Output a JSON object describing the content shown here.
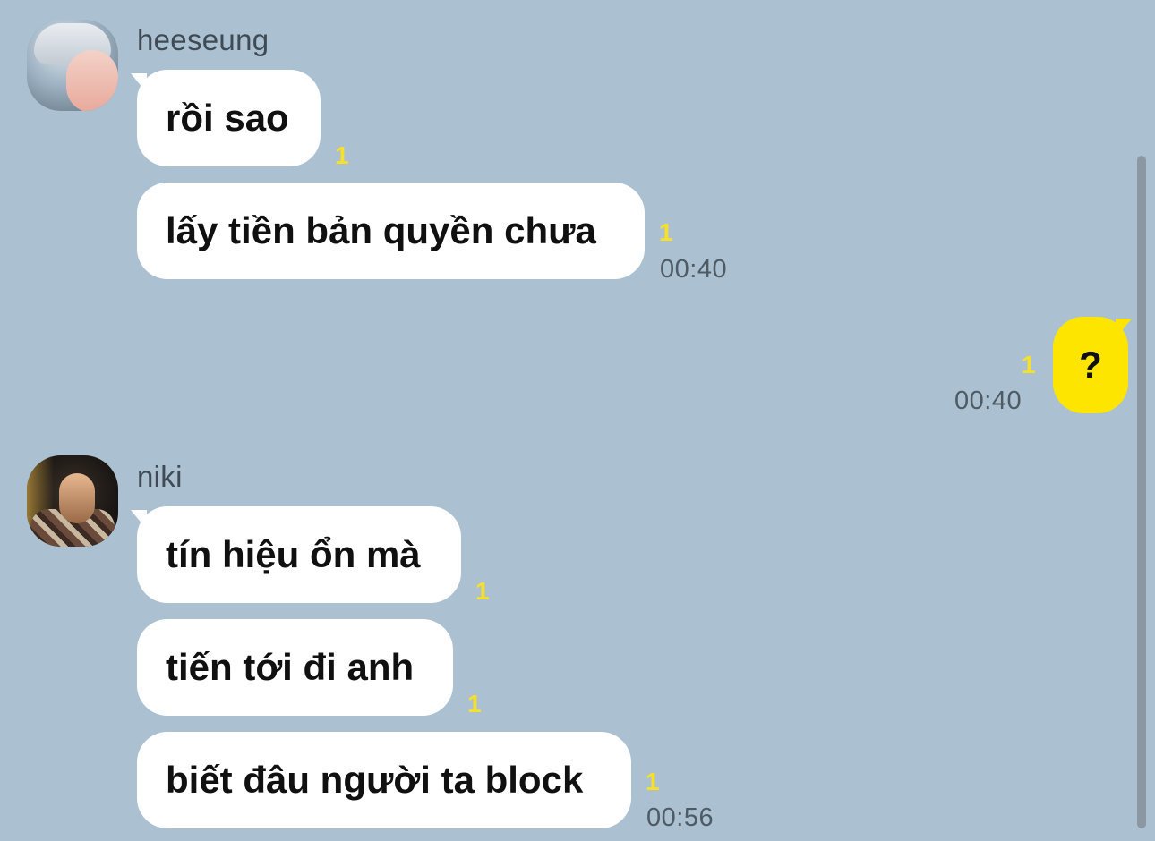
{
  "theme": {
    "background": "#abc1d1",
    "my_bubble_color": "#fee500",
    "their_bubble_color": "#ffffff",
    "unread_color": "#f7e02a"
  },
  "conversation": {
    "groups": [
      {
        "sender": "heeseung",
        "messages": [
          {
            "text": "rồi sao",
            "unread": "1",
            "time": ""
          },
          {
            "text": "lấy tiền bản quyền chưa",
            "unread": "1",
            "time": "00:40"
          }
        ]
      },
      {
        "sender": "me",
        "messages": [
          {
            "text": "?",
            "unread": "1",
            "time": "00:40"
          }
        ]
      },
      {
        "sender": "niki",
        "messages": [
          {
            "text": "tín hiệu ổn mà",
            "unread": "1",
            "time": ""
          },
          {
            "text": "tiến tới đi anh",
            "unread": "1",
            "time": ""
          },
          {
            "text": "biết đâu người ta block",
            "unread": "1",
            "time": "00:56"
          }
        ]
      }
    ]
  }
}
